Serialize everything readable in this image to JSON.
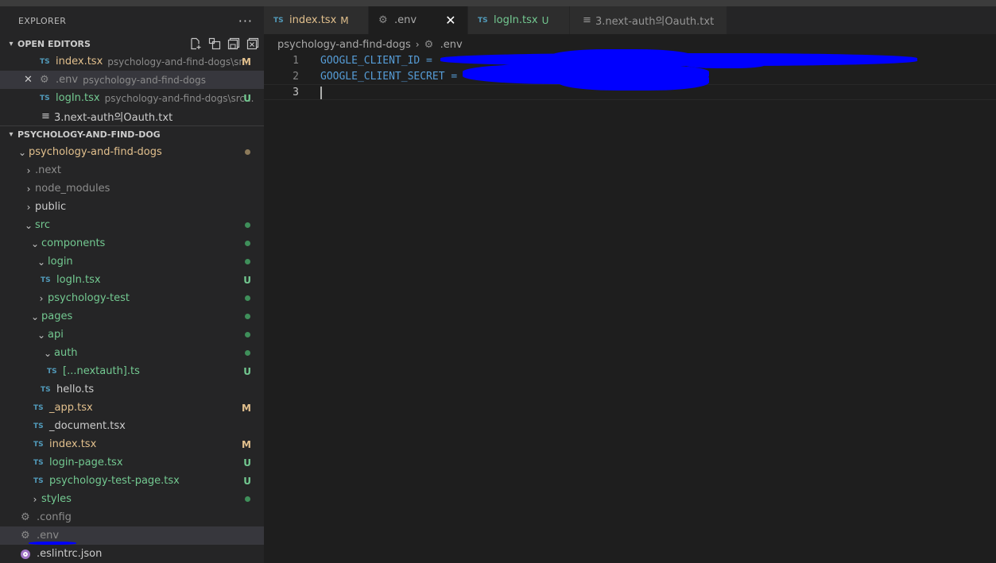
{
  "explorer": {
    "title": "EXPLORER",
    "more_label": "···"
  },
  "open_editors": {
    "header": "OPEN EDITORS",
    "items": [
      {
        "name": "index.tsx",
        "desc": "psychology-and-find-dogs\\sr...",
        "badge": "M"
      },
      {
        "name": ".env",
        "desc": "psychology-and-find-dogs",
        "close": "✕"
      },
      {
        "name": "logIn.tsx",
        "desc": "psychology-and-find-dogs\\src...",
        "badge": "U"
      },
      {
        "name": "3.next-auth의Oauth.txt"
      }
    ]
  },
  "project": {
    "header": "PSYCHOLOGY-AND-FIND-DOG",
    "tree": [
      {
        "label": "psychology-and-find-dogs"
      },
      {
        "label": ".next"
      },
      {
        "label": "node_modules"
      },
      {
        "label": "public"
      },
      {
        "label": "src"
      },
      {
        "label": "components"
      },
      {
        "label": "login"
      },
      {
        "label": "logIn.tsx",
        "badge": "U"
      },
      {
        "label": "psychology-test"
      },
      {
        "label": "pages"
      },
      {
        "label": "api"
      },
      {
        "label": "auth"
      },
      {
        "label": "[...nextauth].ts",
        "badge": "U"
      },
      {
        "label": "hello.ts"
      },
      {
        "label": "_app.tsx",
        "badge": "M"
      },
      {
        "label": "_document.tsx"
      },
      {
        "label": "index.tsx",
        "badge": "M"
      },
      {
        "label": "login-page.tsx",
        "badge": "U"
      },
      {
        "label": "psychology-test-page.tsx",
        "badge": "U"
      },
      {
        "label": "styles"
      },
      {
        "label": ".config"
      },
      {
        "label": ".env"
      },
      {
        "label": ".eslintrc.json"
      }
    ]
  },
  "tabs": [
    {
      "label": "index.tsx",
      "badge": "M",
      "icon": "TS"
    },
    {
      "label": ".env",
      "close": "✕"
    },
    {
      "label": "logIn.tsx",
      "badge": "U",
      "icon": "TS"
    },
    {
      "label": "3.next-auth의Oauth.txt"
    }
  ],
  "breadcrumb": {
    "folder": "psychology-and-find-dogs",
    "file": ".env"
  },
  "editor": {
    "lines": [
      {
        "num": "1",
        "text": "GOOGLE_CLIENT_ID = "
      },
      {
        "num": "2",
        "text": "GOOGLE_CLIENT_SECRET = "
      },
      {
        "num": "3",
        "text": ""
      }
    ]
  },
  "icons": {
    "ts": "TS",
    "gear": "⚙",
    "lines": "≡",
    "chevron_down": "⌄",
    "chevron_right": "›"
  },
  "colors": {
    "modified": "#e2c08d",
    "untracked": "#73c991",
    "redaction": "#0000ff"
  }
}
